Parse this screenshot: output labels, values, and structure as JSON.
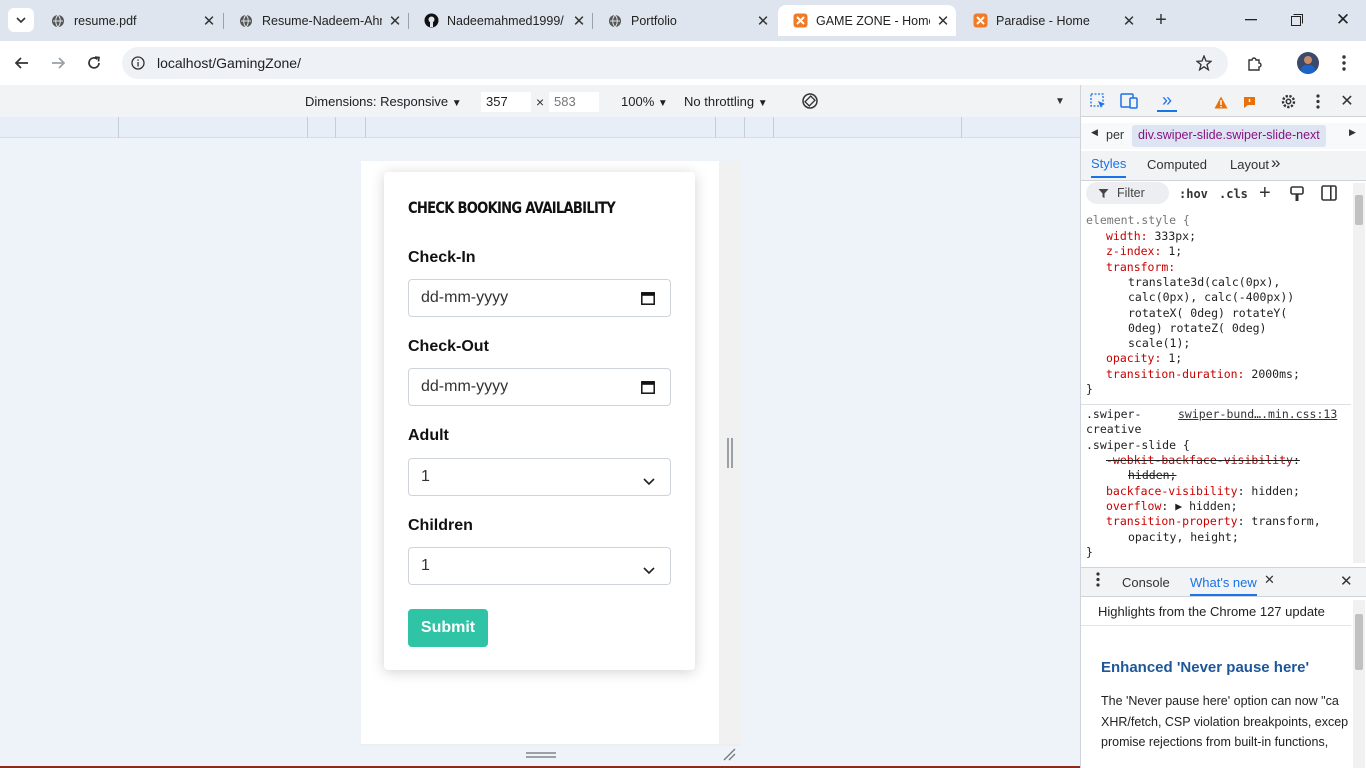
{
  "browser": {
    "tabs": [
      {
        "title": "resume.pdf",
        "icon": "globe-icon"
      },
      {
        "title": "Resume-Nadeem-Ahmed",
        "icon": "globe-icon"
      },
      {
        "title": "Nadeemahmed1999/",
        "icon": "github-icon"
      },
      {
        "title": "Portfolio",
        "icon": "globe-icon"
      },
      {
        "title": "GAME ZONE - Home",
        "icon": "xampp-icon",
        "active": true
      },
      {
        "title": "Paradise - Home",
        "icon": "xampp-icon"
      }
    ],
    "url": "localhost/GamingZone/"
  },
  "devbar": {
    "dimensions_label": "Dimensions: Responsive",
    "width": "357",
    "times": "×",
    "height": "583",
    "zoom": "100%",
    "throttle": "No throttling"
  },
  "form": {
    "title": "CHECK BOOKING AVAILABILITY",
    "checkin_label": "Check-In",
    "checkin_placeholder": "dd-mm-yyyy",
    "checkout_label": "Check-Out",
    "checkout_placeholder": "dd-mm-yyyy",
    "adult_label": "Adult",
    "adult_value": "1",
    "children_label": "Children",
    "children_value": "1",
    "submit_label": "Submit",
    "submit_color": "#2ec4a5"
  },
  "devtools": {
    "breadcrumb_left": "per",
    "breadcrumb": "div.swiper-slide.swiper-slide-next",
    "tabs": [
      "Styles",
      "Computed",
      "Layout"
    ],
    "filter": "Filter",
    "hov": ":hov",
    "cls": ".cls",
    "rule1": {
      "selector": "element.style {",
      "lines": [
        {
          "p": "width",
          "v": " 333px;"
        },
        {
          "p": "z-index",
          "v": " 1;"
        },
        {
          "p": "transform",
          "v": ""
        },
        {
          "p": "",
          "v": "translate3d(calc(0px),"
        },
        {
          "p": "",
          "v": "calc(0px), calc(-400px))"
        },
        {
          "p": "",
          "v": "rotateX(  0deg) rotateY("
        },
        {
          "p": "",
          "v": "  0deg) rotateZ(  0deg)"
        },
        {
          "p": "",
          "v": "scale(1);"
        },
        {
          "p": "opacity",
          "v": " 1;"
        },
        {
          "p": "transition-duration",
          "v": " 2000ms;"
        }
      ],
      "close": "}"
    },
    "rule2": {
      "selector_lines": [
        ".swiper-",
        "creative",
        ".swiper-slide {"
      ],
      "source": "swiper-bund….min.css:13",
      "lines": [
        {
          "p": "-webkit-backface-visibility",
          "v": ":",
          "strike": true
        },
        {
          "p": "",
          "v": "hidden;",
          "strike": true
        },
        {
          "p": "backface-visibility",
          "v": ": hidden;"
        },
        {
          "p": "overflow",
          "v": ": ▶ hidden;"
        },
        {
          "p": "transition-property",
          "v": ": transform,"
        },
        {
          "p": "",
          "v": "opacity, height;"
        }
      ],
      "close": "}"
    },
    "drawer_tabs": [
      "Console",
      "What's new"
    ],
    "whatsnew_header": "Highlights from the Chrome 127 update",
    "whatsnew_title": "Enhanced 'Never pause here'",
    "whatsnew_body": [
      "The 'Never pause here' option can now \"ca",
      "XHR/fetch, CSP violation breakpoints, excep",
      "promise rejections from built-in functions,"
    ]
  }
}
